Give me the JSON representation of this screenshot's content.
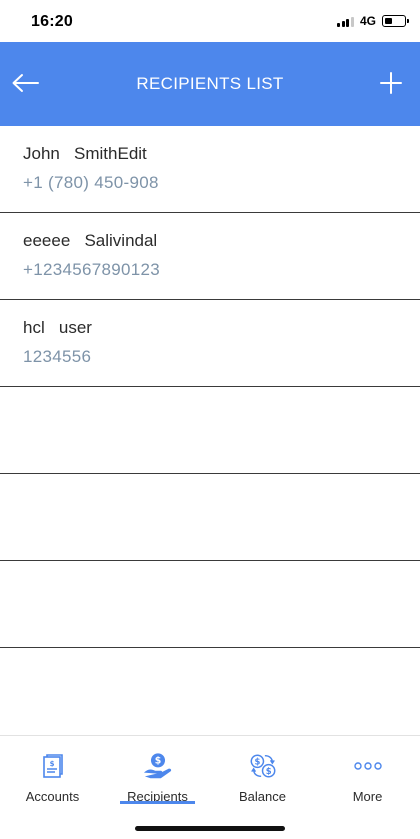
{
  "status_bar": {
    "time": "16:20",
    "network": "4G",
    "battery_fraction": 0.4
  },
  "header": {
    "title": "RECIPIENTS LIST",
    "back_icon": "arrow-left-icon",
    "add_icon": "plus-icon",
    "background_color": "#4d87ec"
  },
  "recipients": [
    {
      "name": "John   SmithEdit",
      "phone": "+1 (780) 450-908"
    },
    {
      "name": "eeeee   Salivindal",
      "phone": "+1234567890123"
    },
    {
      "name": "hcl   user",
      "phone": "1234556"
    },
    {
      "name": "",
      "phone": ""
    },
    {
      "name": "",
      "phone": ""
    },
    {
      "name": "",
      "phone": ""
    },
    {
      "name": "",
      "phone": ""
    }
  ],
  "tabs": [
    {
      "label": "Accounts",
      "icon": "accounts-icon",
      "active": false
    },
    {
      "label": "Recipients",
      "icon": "recipients-icon",
      "active": true
    },
    {
      "label": "Balance",
      "icon": "balance-icon",
      "active": false
    },
    {
      "label": "More",
      "icon": "more-icon",
      "active": false
    }
  ],
  "colors": {
    "accent": "#4d87ec",
    "phone_text": "#7e93a8"
  }
}
